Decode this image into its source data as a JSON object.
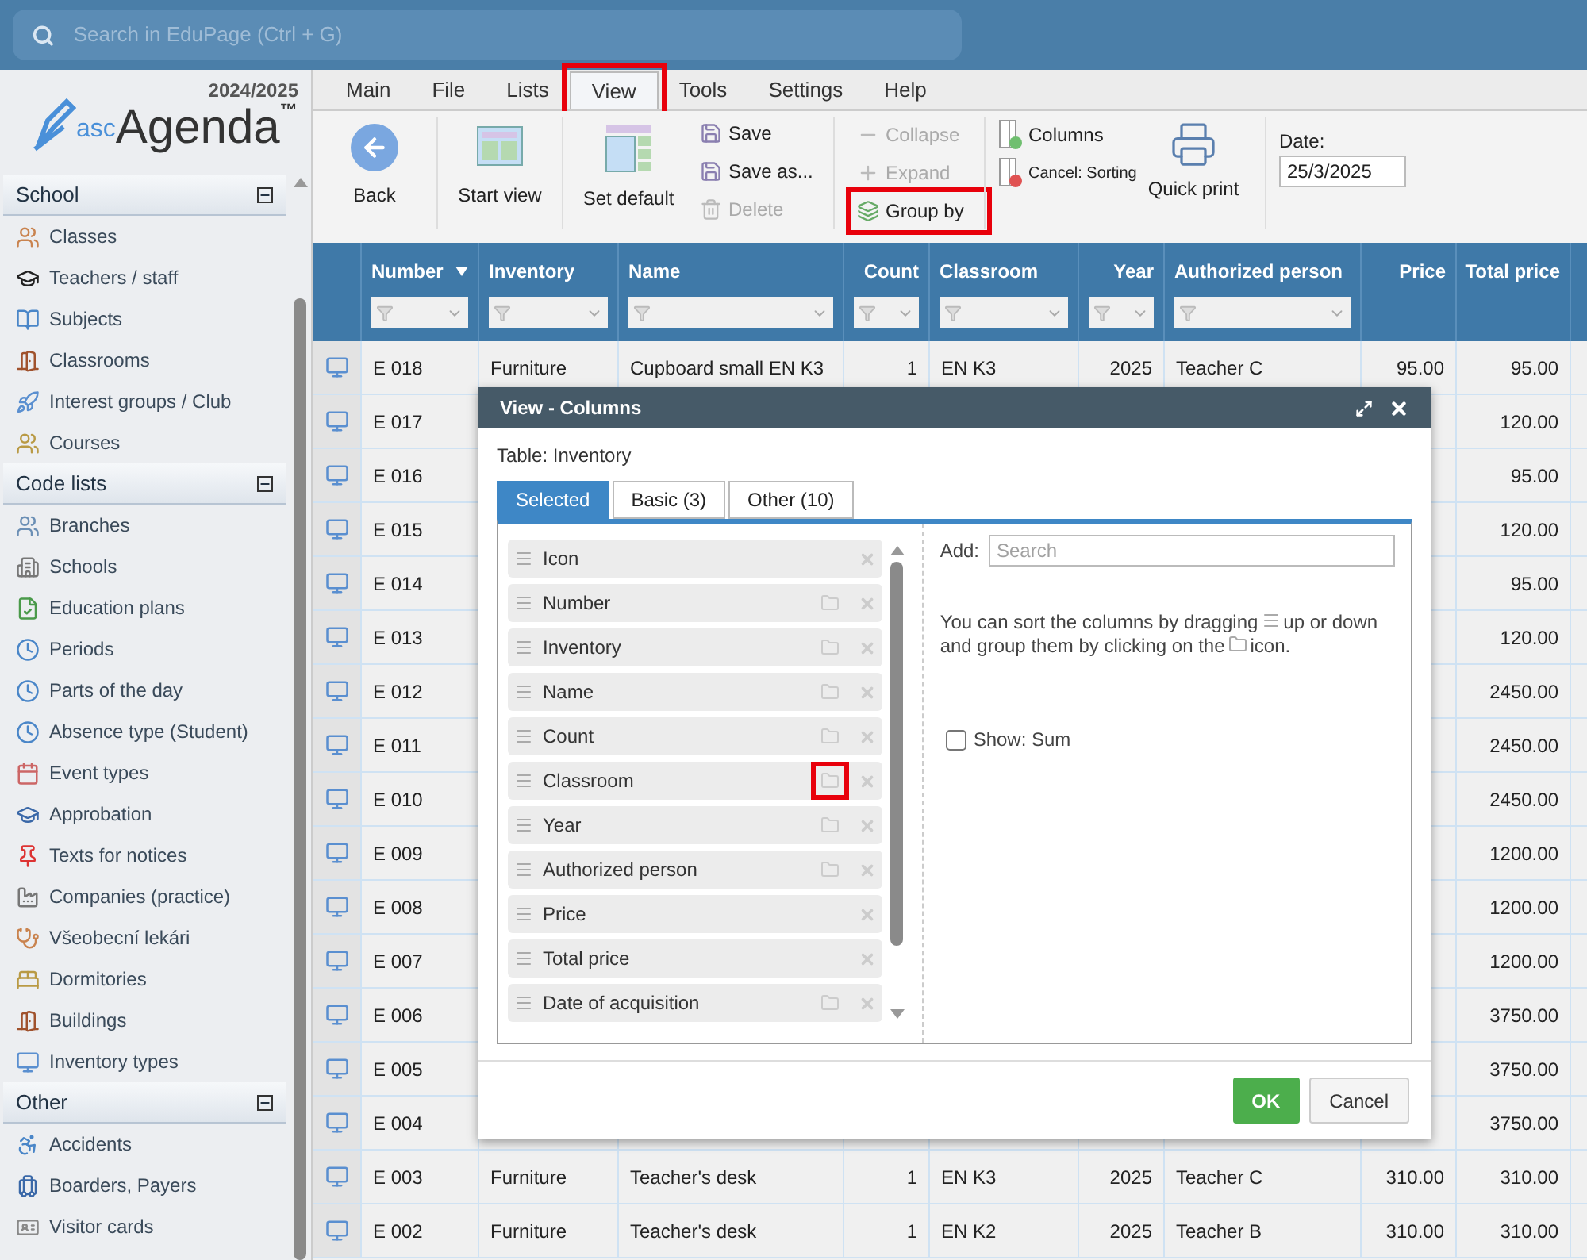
{
  "search": {
    "placeholder": "Search in EduPage (Ctrl + G)"
  },
  "logo": {
    "year": "2024/2025",
    "prefix": "asc",
    "name": "Agenda",
    "tm": "™"
  },
  "sidebar": {
    "sections": [
      {
        "title": "School",
        "expanded": true,
        "items": [
          "Classes",
          "Teachers / staff",
          "Subjects",
          "Classrooms",
          "Interest groups / Club",
          "Courses"
        ]
      },
      {
        "title": "Code lists",
        "expanded": true,
        "items": [
          "Branches",
          "Schools",
          "Education plans",
          "Periods",
          "Parts of the day",
          "Absence type (Student)",
          "Event types",
          "Approbation",
          "Texts for notices",
          "Companies (practice)",
          "Všeobecní lekári",
          "Dormitories",
          "Buildings",
          "Inventory types"
        ]
      },
      {
        "title": "Other",
        "expanded": true,
        "items": [
          "Accidents",
          "Boarders, Payers",
          "Visitor cards"
        ]
      }
    ]
  },
  "menu": [
    {
      "label": "Main",
      "selected": false,
      "highlighted": false
    },
    {
      "label": "File",
      "selected": false,
      "highlighted": false
    },
    {
      "label": "Lists",
      "selected": false,
      "highlighted": false
    },
    {
      "label": "View",
      "selected": true,
      "highlighted": true
    },
    {
      "label": "Tools",
      "selected": false,
      "highlighted": false
    },
    {
      "label": "Settings",
      "selected": false,
      "highlighted": false
    },
    {
      "label": "Help",
      "selected": false,
      "highlighted": false
    }
  ],
  "toolbar": {
    "back": "Back",
    "start_view": "Start view",
    "set_default": "Set default",
    "file_actions": [
      {
        "label": "Save",
        "disabled": false
      },
      {
        "label": "Save as...",
        "disabled": false
      },
      {
        "label": "Delete",
        "disabled": true
      }
    ],
    "group_actions": [
      {
        "label": "Collapse",
        "disabled": true,
        "highlighted": false
      },
      {
        "label": "Expand",
        "disabled": true,
        "highlighted": false
      },
      {
        "label": "Group by",
        "disabled": false,
        "highlighted": true
      }
    ],
    "column_actions": [
      {
        "label": "Columns",
        "kind": "add"
      },
      {
        "label": "Cancel: Sorting",
        "kind": "cancel"
      }
    ],
    "quick_print": "Quick print",
    "date": {
      "label": "Date:",
      "value": "25/3/2025"
    }
  },
  "table": {
    "columns": [
      {
        "label": "Number",
        "sorted": true,
        "filter": true
      },
      {
        "label": "Inventory",
        "sorted": false,
        "filter": true
      },
      {
        "label": "Name",
        "sorted": false,
        "filter": true
      },
      {
        "label": "Count",
        "sorted": false,
        "filter": true
      },
      {
        "label": "Classroom",
        "sorted": false,
        "filter": true
      },
      {
        "label": "Year",
        "sorted": false,
        "filter": true
      },
      {
        "label": "Authorized person",
        "sorted": false,
        "filter": true
      },
      {
        "label": "Price",
        "sorted": false,
        "filter": false
      },
      {
        "label": "Total price",
        "sorted": false,
        "filter": false
      }
    ],
    "rows": [
      {
        "number": "E 018",
        "inventory": "Furniture",
        "name": "Cupboard small EN K3",
        "count": "1",
        "classroom": "EN K3",
        "year": "2025",
        "person": "Teacher C",
        "price": "95.00",
        "total": "95.00"
      },
      {
        "number": "E 017",
        "total": "120.00"
      },
      {
        "number": "E 016",
        "total": "95.00"
      },
      {
        "number": "E 015",
        "total": "120.00"
      },
      {
        "number": "E 014",
        "total": "95.00"
      },
      {
        "number": "E 013",
        "total": "120.00"
      },
      {
        "number": "E 012",
        "total": "2450.00"
      },
      {
        "number": "E 011",
        "total": "2450.00"
      },
      {
        "number": "E 010",
        "total": "2450.00"
      },
      {
        "number": "E 009",
        "total": "1200.00"
      },
      {
        "number": "E 008",
        "total": "1200.00"
      },
      {
        "number": "E 007",
        "total": "1200.00"
      },
      {
        "number": "E 006",
        "total": "3750.00"
      },
      {
        "number": "E 005",
        "total": "3750.00"
      },
      {
        "number": "E 004",
        "total": "3750.00"
      },
      {
        "number": "E 003",
        "inventory": "Furniture",
        "name": "Teacher's desk",
        "count": "1",
        "classroom": "EN K3",
        "year": "2025",
        "person": "Teacher C",
        "price": "310.00",
        "total": "310.00"
      },
      {
        "number": "E 002",
        "inventory": "Furniture",
        "name": "Teacher's desk",
        "count": "1",
        "classroom": "EN K2",
        "year": "2025",
        "person": "Teacher B",
        "price": "310.00",
        "total": "310.00"
      }
    ]
  },
  "dialog": {
    "title": "View - Columns",
    "table_label": "Table: Inventory",
    "tabs": [
      {
        "label": "Selected",
        "selected": true
      },
      {
        "label": "Basic (3)",
        "selected": false
      },
      {
        "label": "Other (10)",
        "selected": false
      }
    ],
    "columns": [
      {
        "label": "Icon",
        "groupable": false
      },
      {
        "label": "Number",
        "groupable": true,
        "highlighted": false
      },
      {
        "label": "Inventory",
        "groupable": true,
        "highlighted": false
      },
      {
        "label": "Name",
        "groupable": true,
        "highlighted": false
      },
      {
        "label": "Count",
        "groupable": true,
        "highlighted": false
      },
      {
        "label": "Classroom",
        "groupable": true,
        "highlighted": true
      },
      {
        "label": "Year",
        "groupable": true,
        "highlighted": false
      },
      {
        "label": "Authorized person",
        "groupable": true,
        "highlighted": false
      },
      {
        "label": "Price",
        "groupable": false
      },
      {
        "label": "Total price",
        "groupable": false
      },
      {
        "label": "Date of acquisition",
        "groupable": true,
        "highlighted": false
      }
    ],
    "add_label": "Add:",
    "search_placeholder": "Search",
    "help": [
      "You can sort the columns by dragging",
      "up or down",
      "and group them by clicking on the",
      "icon."
    ],
    "show_sum": {
      "label": "Show: Sum",
      "checked": false
    },
    "buttons": [
      {
        "label": "OK",
        "kind": "primary"
      },
      {
        "label": "Cancel",
        "kind": "secondary"
      }
    ]
  }
}
